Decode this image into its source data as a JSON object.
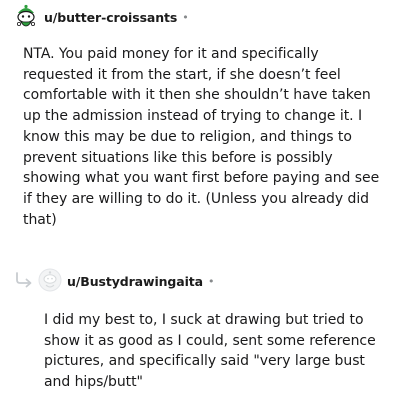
{
  "comments": [
    {
      "username": "u/butter-croissants",
      "separator": "•",
      "avatar_icon": "snoo-avatar-green-icon",
      "body": "NTA. You paid money for it and specifically requested it from the start, if she doesn’t feel comfortable with it then she shouldn’t have taken up the admission instead of trying to change it. I know this may be due to religion, and things to prevent situations like this before is possibly showing what you want first before paying and see if they are willing to do it. (Unless you already did that)"
    },
    {
      "username": "u/Bustydrawingaita",
      "separator": "•",
      "avatar_icon": "default-avatar-icon",
      "reply_icon": "reply-arrow-icon",
      "body": "I did my best to, I suck at drawing but tried to show it as good as I could, sent some reference pictures, and specifically said \"very large bust and hips/butt\""
    }
  ]
}
